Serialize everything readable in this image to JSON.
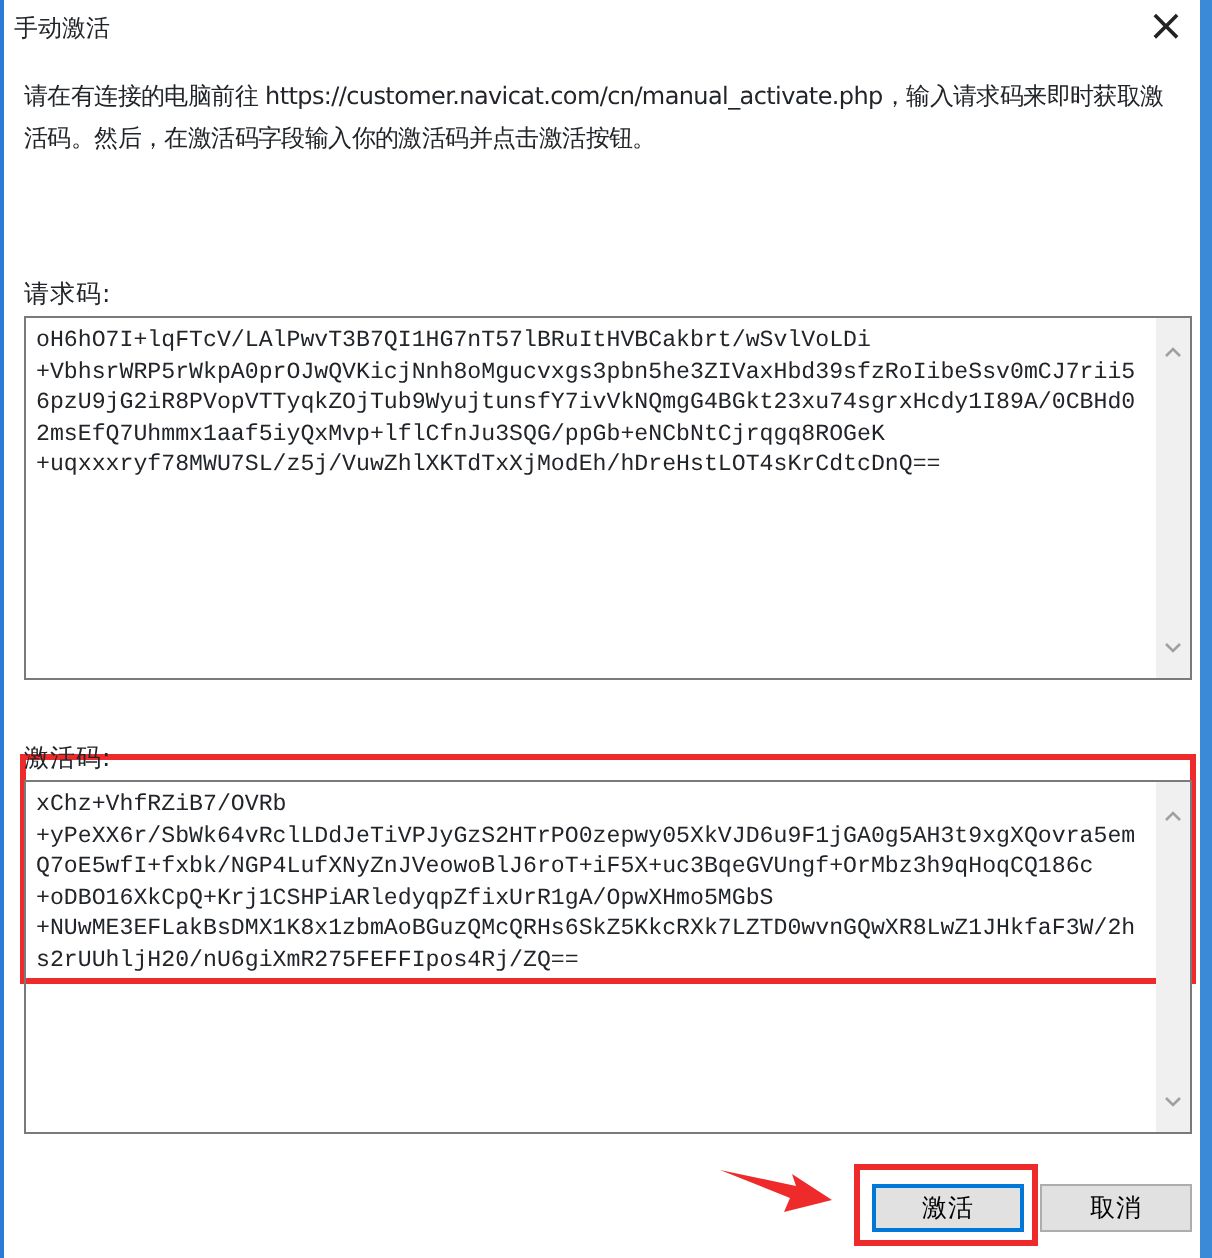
{
  "window": {
    "title": "手动激活",
    "close": "×"
  },
  "instructions": "请在有连接的电脑前往 https://customer.navicat.com/cn/manual_activate.php，输入请求码来即时获取激活码。然后，在激活码字段输入你的激活码并点击激活按钮。",
  "request_code": {
    "label": "请求码:",
    "lines": [
      "oH6hO7I+lqFTcV/LAlPwvT3B7QI1HG7nT57lBRuItHVBCakbrt/wSvlVoLDi",
      "+VbhsrWRP5rWkpA0prOJwQVKicjNnh8oMgucvxgs3pbn5he3ZIVaxHbd39sfzRoIibeSsv0mCJ7rii5",
      "6pzU9jG2iR8PVopVTTyqkZOjTub9WyujtunsfY7ivVkNQmgG4BGkt23xu74sgrxHcdy1I89A/0CBHd0",
      "2msEfQ7Uhmmx1aaf5iyQxMvp+lflCfnJu3SQG/ppGb+eNCbNtCjrqgq8ROGeK",
      "+uqxxxryf78MWU7SL/z5j/VuwZhlXKTdTxXjModEh/hDreHstLOT4sKrCdtcDnQ=="
    ]
  },
  "activation_code": {
    "label": "激活码:",
    "lines": [
      "xChz+VhfRZiB7/OVRb",
      "+yPeXX6r/SbWk64vRclLDdJeTiVPJyGzS2HTrPO0zepwy05XkVJD6u9F1jGA0g5AH3t9xgXQovra5em",
      "Q7oE5wfI+fxbk/NGP4LufXNyZnJVeowoBlJ6roT+iF5X+uc3BqeGVUngf+OrMbz3h9qHoqCQ186c",
      "+oDBO16XkCpQ+Krj1CSHPiARledyqpZfixUrR1gA/OpwXHmo5MGbS",
      "+NUwME3EFLakBsDMX1K8x1zbmAoBGuzQMcQRHs6SkZ5KkcRXk7LZTD0wvnGQwXR8LwZ1JHkfaF3W/2h",
      "s2rUUhljH20/nU6giXmR275FEFFIpos4Rj/ZQ=="
    ]
  },
  "buttons": [
    {
      "label": "激活",
      "focused": true
    },
    {
      "label": "取消",
      "focused": false
    }
  ]
}
